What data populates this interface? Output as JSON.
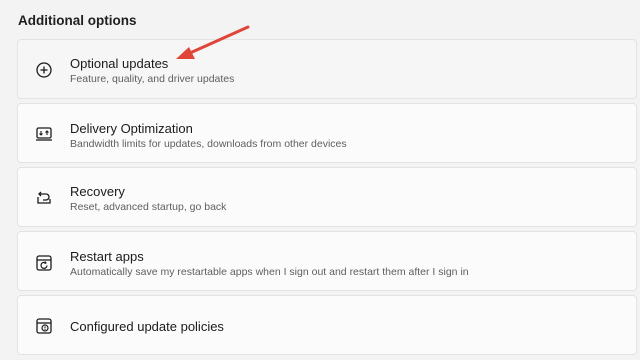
{
  "section": {
    "title": "Additional options"
  },
  "options": [
    {
      "title": "Optional updates",
      "subtitle": "Feature, quality, and driver updates",
      "icon": "plus-circle-icon"
    },
    {
      "title": "Delivery Optimization",
      "subtitle": "Bandwidth limits for updates, downloads from other devices",
      "icon": "delivery-optimization-icon"
    },
    {
      "title": "Recovery",
      "subtitle": "Reset, advanced startup, go back",
      "icon": "recovery-icon"
    },
    {
      "title": "Restart apps",
      "subtitle": "Automatically save my restartable apps when I sign out and restart them after I sign in",
      "icon": "restart-apps-icon"
    },
    {
      "title": "Configured update policies",
      "icon": "update-policies-icon"
    }
  ],
  "annotation": {
    "color": "#e0453a"
  }
}
